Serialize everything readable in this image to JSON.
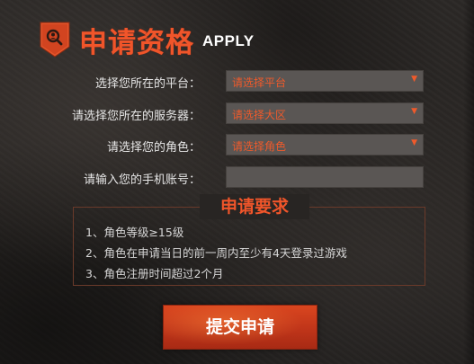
{
  "header": {
    "title": "申请资格",
    "title_en": "APPLY",
    "badge_icon": "search-user-badge-icon"
  },
  "form": {
    "rows": [
      {
        "label": "选择您所在的平台：",
        "value": "请选择平台",
        "type": "select"
      },
      {
        "label": "请选择您所在的服务器：",
        "value": "请选择大区",
        "type": "select"
      },
      {
        "label": "请选择您的角色：",
        "value": "请选择角色",
        "type": "select"
      },
      {
        "label": "请输入您的手机账号：",
        "value": "",
        "type": "input"
      }
    ],
    "caret_icon": "▼"
  },
  "requirements": {
    "title": "申请要求",
    "items": [
      "1、角色等级≥15级",
      "2、角色在申请当日的前一周内至少有4天登录过游戏",
      "3、角色注册时间超过2个月"
    ]
  },
  "submit": {
    "label": "提交申请"
  },
  "colors": {
    "accent": "#f0552a",
    "field_bg": "#5a5654",
    "button": "#c2361a"
  }
}
